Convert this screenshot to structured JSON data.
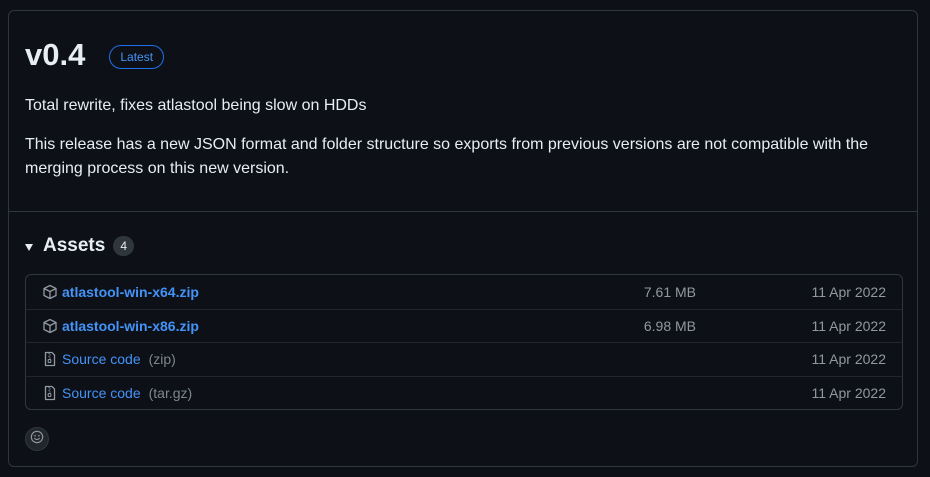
{
  "release": {
    "title": "v0.4",
    "badge": "Latest",
    "summary": "Total rewrite, fixes atlastool being slow on HDDs",
    "body": "This release has a new JSON format and folder structure so exports from previous versions are not compatible with the merging process on this new version."
  },
  "assets": {
    "title": "Assets",
    "count": "4",
    "items": [
      {
        "name": "atlastool-win-x64.zip",
        "format": "",
        "size": "7.61 MB",
        "date": "11 Apr 2022",
        "icon": "package-icon"
      },
      {
        "name": "atlastool-win-x86.zip",
        "format": "",
        "size": "6.98 MB",
        "date": "11 Apr 2022",
        "icon": "package-icon"
      },
      {
        "name": "Source code",
        "format": "(zip)",
        "size": "",
        "date": "11 Apr 2022",
        "icon": "file-zip-icon"
      },
      {
        "name": "Source code",
        "format": "(tar.gz)",
        "size": "",
        "date": "11 Apr 2022",
        "icon": "file-zip-icon"
      }
    ]
  },
  "colors": {
    "background": "#0d1117",
    "border": "#30363d",
    "link": "#4493f8",
    "muted": "#9198a1",
    "text": "#e6edf3"
  }
}
